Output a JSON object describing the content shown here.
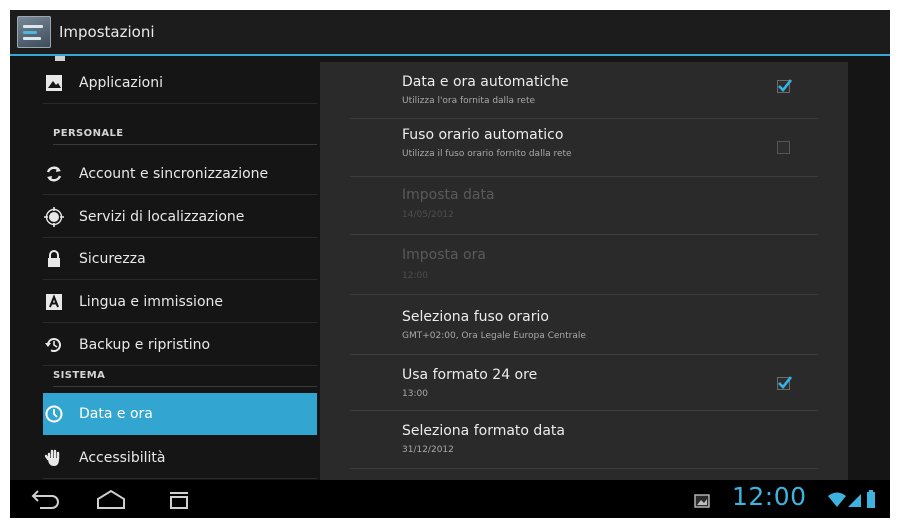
{
  "app": {
    "title": "Impostazioni"
  },
  "sidebar": {
    "items": [
      {
        "label": "Applicazioni",
        "icon": "apps-icon"
      },
      {
        "label": "Account e sincronizzazione",
        "icon": "sync-icon"
      },
      {
        "label": "Servizi di localizzazione",
        "icon": "location-icon"
      },
      {
        "label": "Sicurezza",
        "icon": "lock-icon"
      },
      {
        "label": "Lingua e immissione",
        "icon": "language-icon"
      },
      {
        "label": "Backup e ripristino",
        "icon": "backup-icon"
      },
      {
        "label": "Data e ora",
        "icon": "clock-icon",
        "selected": true
      },
      {
        "label": "Accessibilità",
        "icon": "hand-icon"
      }
    ],
    "sections": {
      "personal": "PERSONALE",
      "system": "SISTEMA"
    }
  },
  "settings": {
    "auto_datetime": {
      "title": "Data e ora automatiche",
      "summary": "Utilizza l'ora fornita dalla rete",
      "checked": true
    },
    "auto_timezone": {
      "title": "Fuso orario automatico",
      "summary": "Utilizza il fuso orario fornito dalla rete",
      "checked": false
    },
    "set_date": {
      "title": "Imposta data",
      "summary": "14/05/2012",
      "enabled": false
    },
    "set_time": {
      "title": "Imposta ora",
      "summary": "12:00",
      "enabled": false
    },
    "timezone": {
      "title": "Seleziona fuso orario",
      "summary": "GMT+02:00, Ora Legale Europa Centrale"
    },
    "format24": {
      "title": "Usa formato 24 ore",
      "summary": "13:00",
      "checked": true
    },
    "date_format": {
      "title": "Seleziona formato data",
      "summary": "31/12/2012"
    }
  },
  "statusbar": {
    "time": "12:00"
  },
  "colors": {
    "accent": "#33a5d1",
    "background": "#151515",
    "pane": "#2a2a2a"
  }
}
